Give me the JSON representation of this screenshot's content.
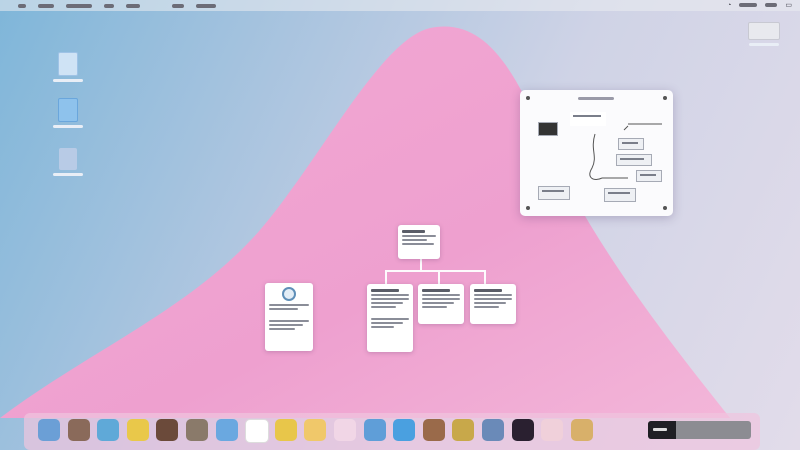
{
  "window": {
    "title": ""
  },
  "dock": {
    "items": [
      {
        "name": "photos-icon",
        "color": "#6b9fd6"
      },
      {
        "name": "globe-icon",
        "color": "#8a6a5a"
      },
      {
        "name": "maps-icon",
        "color": "#5fa9d8"
      },
      {
        "name": "notes-icon",
        "color": "#e9c84a"
      },
      {
        "name": "books-icon",
        "color": "#6b4a3a"
      },
      {
        "name": "photos-2-icon",
        "color": "#8a7a6a"
      },
      {
        "name": "app-store-icon",
        "color": "#6aa8e0"
      },
      {
        "name": "document-icon",
        "color": "#ffffff"
      },
      {
        "name": "keynote-icon",
        "color": "#e8c64a"
      },
      {
        "name": "reminders-icon",
        "color": "#f0c86a"
      },
      {
        "name": "pages-icon",
        "color": "#f1d6e6"
      },
      {
        "name": "preview-icon",
        "color": "#5f9ed8"
      },
      {
        "name": "finder-icon",
        "color": "#4aa0e0"
      },
      {
        "name": "safari-icon",
        "color": "#9a6a4a"
      },
      {
        "name": "music-icon",
        "color": "#c8a84a"
      },
      {
        "name": "contacts-icon",
        "color": "#6a8ab8"
      },
      {
        "name": "terminal-icon",
        "color": "#2a2030"
      },
      {
        "name": "sketch-icon",
        "color": "#f0d0da"
      },
      {
        "name": "weather-icon",
        "color": "#d8b06a"
      }
    ]
  }
}
